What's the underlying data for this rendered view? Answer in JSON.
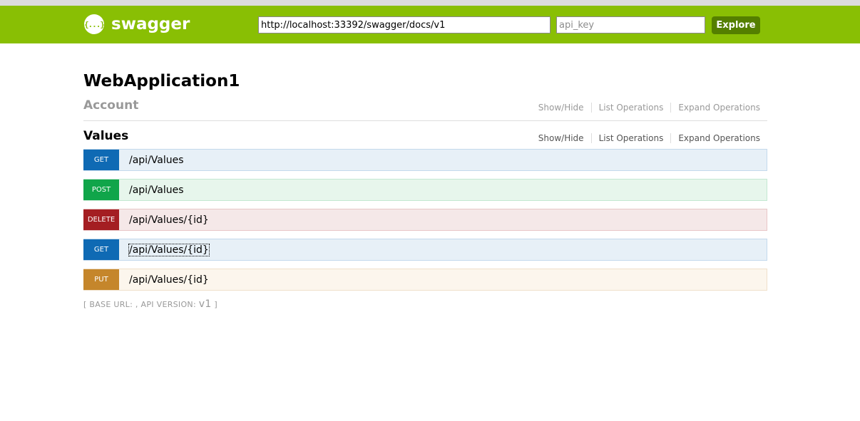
{
  "header": {
    "logo_icon": "{...}",
    "logo_text": "swagger",
    "url_value": "http://localhost:33392/swagger/docs/v1",
    "api_key_placeholder": "api_key",
    "explore_label": "Explore"
  },
  "title": "WebApplication1",
  "resources": [
    {
      "name": "Account",
      "links": [
        "Show/Hide",
        "List Operations",
        "Expand Operations"
      ]
    },
    {
      "name": "Values",
      "links": [
        "Show/Hide",
        "List Operations",
        "Expand Operations"
      ],
      "operations": [
        {
          "method": "GET",
          "path": "/api/Values"
        },
        {
          "method": "POST",
          "path": "/api/Values"
        },
        {
          "method": "DELETE",
          "path": "/api/Values/{id}"
        },
        {
          "method": "GET",
          "path": "/api/Values/{id}"
        },
        {
          "method": "PUT",
          "path": "/api/Values/{id}"
        }
      ]
    }
  ],
  "footer": {
    "open": "[ ",
    "base_url_label": "BASE URL",
    "sep1": ": , ",
    "api_version_label": "API VERSION",
    "sep2": ": ",
    "api_version": "v1",
    "close": " ]"
  },
  "colors": {
    "brand": "#89bf04",
    "explore": "#547f00",
    "get": "#0f6ab4",
    "post": "#10a54a",
    "delete": "#a41e22",
    "put": "#c5862b"
  }
}
